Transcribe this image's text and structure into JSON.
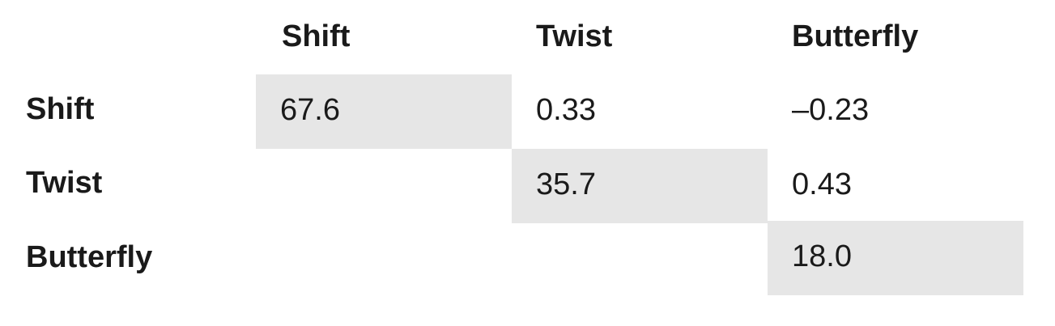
{
  "columns": [
    "Shift",
    "Twist",
    "Butterfly"
  ],
  "rows": [
    {
      "label": "Shift",
      "values": [
        "67.6",
        "0.33",
        "–0.23"
      ]
    },
    {
      "label": "Twist",
      "values": [
        "",
        "35.7",
        "0.43"
      ]
    },
    {
      "label": "Butterfly",
      "values": [
        "",
        "",
        "18.0"
      ]
    }
  ],
  "colors": {
    "diagonal_fill": "#e6e6e6",
    "text": "#1a1a1a",
    "background": "#ffffff"
  }
}
